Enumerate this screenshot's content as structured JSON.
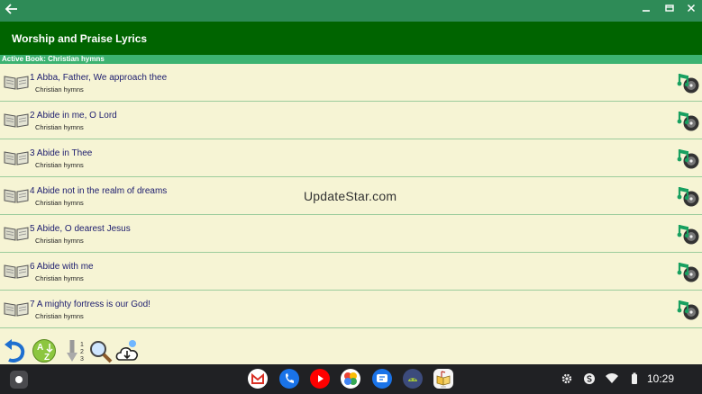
{
  "app": {
    "title": "Worship and Praise Lyrics",
    "active_book": "Active Book: Christian hymns"
  },
  "watermark": "UpdateStar.com",
  "hymns": [
    {
      "title": "1 Abba, Father, We approach thee",
      "book": "Christian hymns"
    },
    {
      "title": "2 Abide in me, O Lord",
      "book": "Christian hymns"
    },
    {
      "title": "3 Abide in Thee",
      "book": "Christian hymns"
    },
    {
      "title": "4 Abide not in the realm of dreams",
      "book": "Christian hymns"
    },
    {
      "title": "5 Abide, O dearest Jesus",
      "book": "Christian hymns"
    },
    {
      "title": "6 Abide with me",
      "book": "Christian hymns"
    },
    {
      "title": "7 A mighty fortress is our God!",
      "book": "Christian hymns"
    }
  ],
  "toolbar": {
    "icons": [
      "undo-icon",
      "a-to-z-sort-icon",
      "number-sort-icon",
      "search-icon",
      "cloud-download-icon"
    ],
    "sort_digits": [
      "1",
      "2",
      "3"
    ],
    "sort_letters": [
      "A",
      "Z"
    ]
  },
  "taskbar": {
    "apps": [
      "gmail",
      "phone",
      "youtube",
      "photos",
      "messages",
      "android-studio",
      "hymn-app"
    ],
    "time": "10:29"
  },
  "colors": {
    "window_bar": "#2e8b57",
    "header": "#006400",
    "active_book_bar": "#3cb371",
    "list_bg": "#f6f4d4",
    "separator": "#9ccc9c",
    "title_text": "#1c1c6e"
  }
}
